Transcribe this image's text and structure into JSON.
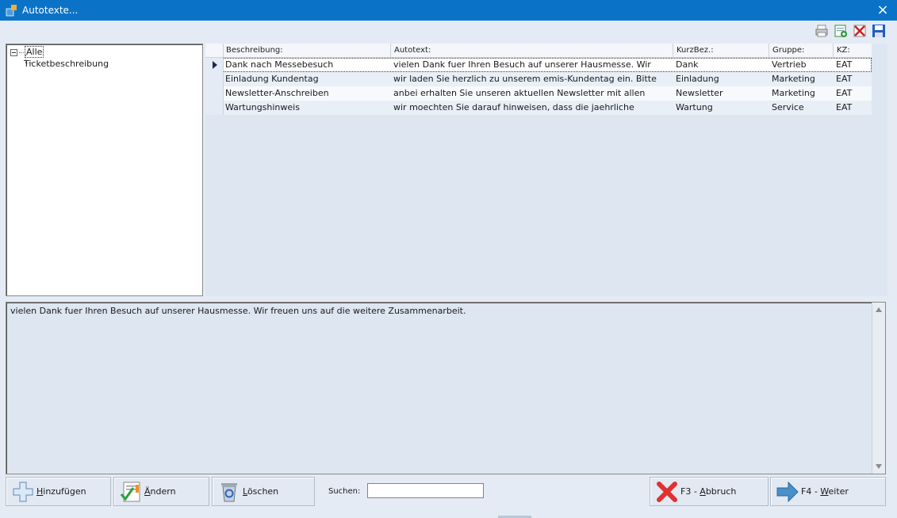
{
  "window": {
    "title": "Autotexte..."
  },
  "tree": {
    "root_label": "Alle",
    "children": [
      "Ticketbeschreibung"
    ]
  },
  "grid": {
    "headers": [
      "Beschreibung:",
      "Autotext:",
      "KurzBez.:",
      "Gruppe:",
      "KZ:"
    ],
    "rows": [
      {
        "beschreibung": "Dank nach Messebesuch",
        "autotext": "vielen Dank fuer Ihren Besuch auf unserer Hausmesse. Wir",
        "kurzbez": "Dank",
        "gruppe": "Vertrieb",
        "kz": "EAT",
        "selected": true
      },
      {
        "beschreibung": "Einladung Kundentag",
        "autotext": "wir laden Sie herzlich zu unserem emis-Kundentag ein. Bitte",
        "kurzbez": "Einladung",
        "gruppe": "Marketing",
        "kz": "EAT"
      },
      {
        "beschreibung": "Newsletter-Anschreiben",
        "autotext": "anbei erhalten Sie unseren aktuellen Newsletter mit allen",
        "kurzbez": "Newsletter",
        "gruppe": "Marketing",
        "kz": "EAT"
      },
      {
        "beschreibung": "Wartungshinweis",
        "autotext": "wir moechten Sie darauf hinweisen, dass die jaehrliche",
        "kurzbez": "Wartung",
        "gruppe": "Service",
        "kz": "EAT"
      }
    ]
  },
  "memo": {
    "text": "vielen Dank fuer Ihren Besuch auf unserer Hausmesse. Wir freuen uns auf die weitere Zusammenarbeit."
  },
  "buttons": {
    "add": {
      "accel": "H",
      "rest": "inzufügen"
    },
    "edit": {
      "accel": "Ä",
      "rest": "ndern"
    },
    "delete": {
      "accel": "L",
      "rest": "öschen"
    },
    "cancel": {
      "pre": "F3 - ",
      "accel": "A",
      "rest": "bbruch"
    },
    "next": {
      "pre": "F4 - ",
      "accel": "W",
      "rest": "eiter"
    }
  },
  "search": {
    "label": "Suchen:",
    "value": ""
  },
  "icons": {
    "app": "app-icon",
    "print": "printer-icon",
    "new": "new-document-icon",
    "delete": "delete-x-icon",
    "save": "floppy-save-icon",
    "add": "plus-icon",
    "edit": "edit-check-icon",
    "trash": "recycle-bin-icon",
    "cancel": "red-x-icon",
    "next": "arrow-right-icon"
  }
}
